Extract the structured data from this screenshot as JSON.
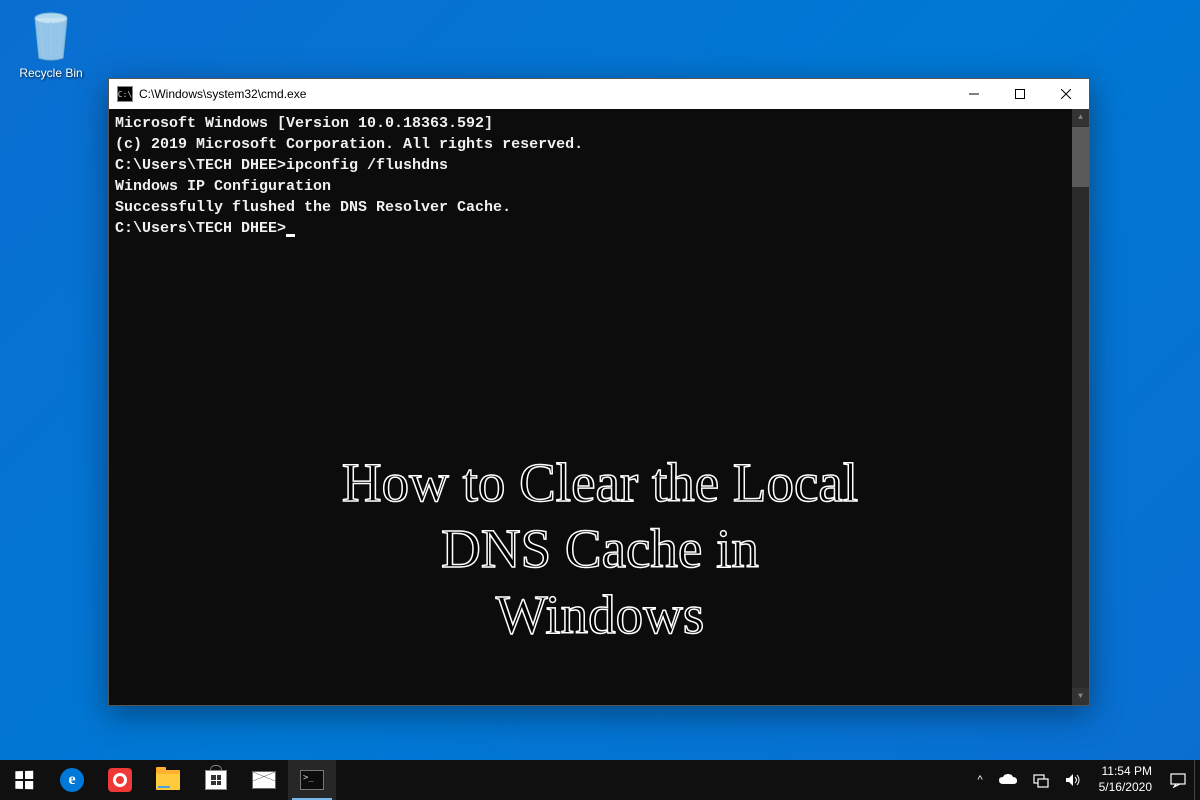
{
  "desktop": {
    "recycle_bin_label": "Recycle Bin"
  },
  "cmd": {
    "title": "C:\\Windows\\system32\\cmd.exe",
    "icon_glyph": "C:\\",
    "lines": [
      "Microsoft Windows [Version 10.0.18363.592]",
      "(c) 2019 Microsoft Corporation. All rights reserved.",
      "",
      "C:\\Users\\TECH DHEE>ipconfig /flushdns",
      "",
      "Windows IP Configuration",
      "",
      "Successfully flushed the DNS Resolver Cache.",
      "",
      "C:\\Users\\TECH DHEE>"
    ]
  },
  "overlay": {
    "line1": "How to Clear the Local",
    "line2": "DNS Cache in",
    "line3": "Windows"
  },
  "taskbar": {
    "edge_glyph": "e",
    "cmd_glyph": ">_"
  },
  "tray": {
    "chevron": "^",
    "time": "11:54 PM",
    "date": "5/16/2020"
  }
}
